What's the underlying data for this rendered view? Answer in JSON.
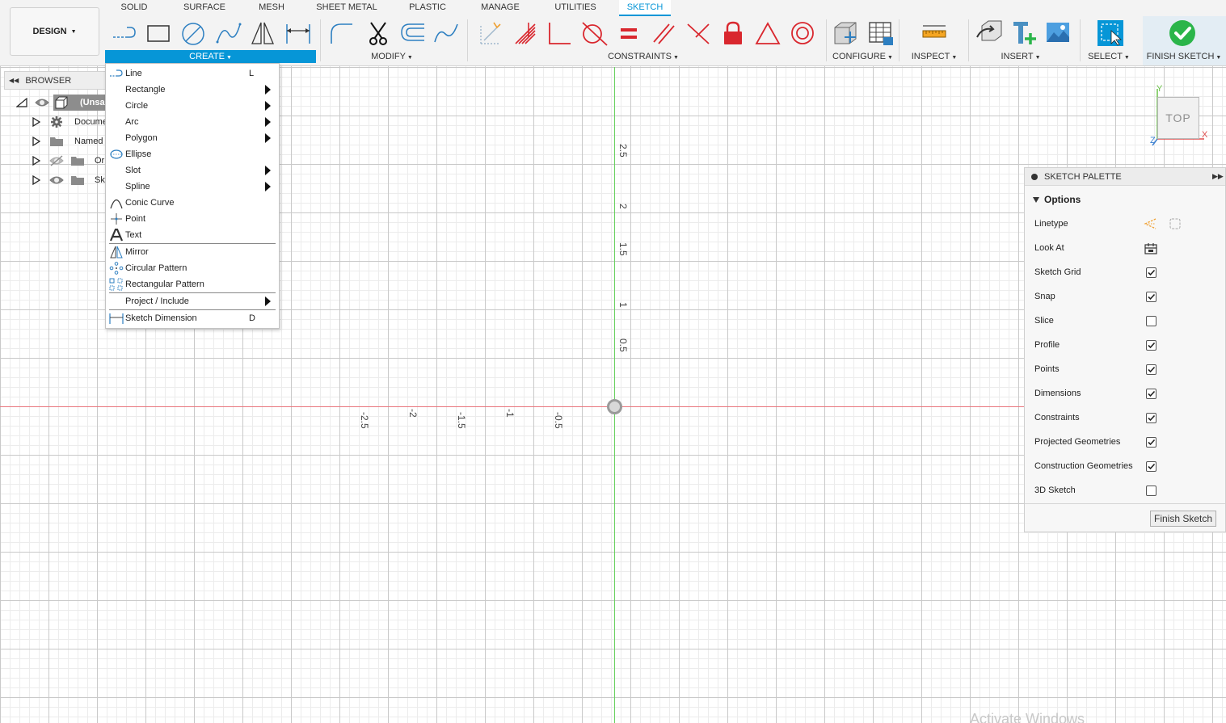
{
  "workspace": {
    "label": "DESIGN"
  },
  "tabs": [
    {
      "label": "SOLID"
    },
    {
      "label": "SURFACE"
    },
    {
      "label": "MESH"
    },
    {
      "label": "SHEET METAL"
    },
    {
      "label": "PLASTIC"
    },
    {
      "label": "MANAGE"
    },
    {
      "label": "UTILITIES"
    },
    {
      "label": "SKETCH"
    }
  ],
  "groups": {
    "create": "CREATE",
    "modify": "MODIFY",
    "constraints": "CONSTRAINTS",
    "configure": "CONFIGURE",
    "inspect": "INSPECT",
    "insert": "INSERT",
    "select": "SELECT",
    "finish": "FINISH SKETCH"
  },
  "browser": {
    "title": "BROWSER",
    "root": "(Unsa",
    "items": [
      {
        "label": "Docume"
      },
      {
        "label": "Named V"
      },
      {
        "label": "Or"
      },
      {
        "label": "Sk"
      }
    ]
  },
  "create_menu": {
    "items": [
      {
        "label": "Line",
        "shortcut": "L"
      },
      {
        "label": "Rectangle"
      },
      {
        "label": "Circle"
      },
      {
        "label": "Arc"
      },
      {
        "label": "Polygon"
      },
      {
        "label": "Ellipse"
      },
      {
        "label": "Slot"
      },
      {
        "label": "Spline"
      },
      {
        "label": "Conic Curve"
      },
      {
        "label": "Point"
      },
      {
        "label": "Text"
      },
      {
        "label": "Mirror"
      },
      {
        "label": "Circular Pattern"
      },
      {
        "label": "Rectangular Pattern"
      },
      {
        "label": "Project / Include"
      },
      {
        "label": "Sketch Dimension",
        "shortcut": "D"
      }
    ]
  },
  "axis_labels": {
    "y": [
      "2.5",
      "2",
      "1.5",
      "1",
      "0.5"
    ],
    "x": [
      "-2.5",
      "-2",
      "-1.5",
      "-1",
      "-0.5"
    ]
  },
  "viewcube": {
    "face": "TOP",
    "axis_y": "Y",
    "axis_x": "X",
    "axis_z": "Z"
  },
  "palette": {
    "title": "SKETCH PALETTE",
    "section": "Options",
    "rows": [
      {
        "label": "Linetype"
      },
      {
        "label": "Look At"
      },
      {
        "label": "Sketch Grid",
        "checked": true
      },
      {
        "label": "Snap",
        "checked": true
      },
      {
        "label": "Slice",
        "checked": false
      },
      {
        "label": "Profile",
        "checked": true
      },
      {
        "label": "Points",
        "checked": true
      },
      {
        "label": "Dimensions",
        "checked": true
      },
      {
        "label": "Constraints",
        "checked": true
      },
      {
        "label": "Projected Geometries",
        "checked": true
      },
      {
        "label": "Construction Geometries",
        "checked": true
      },
      {
        "label": "3D Sketch",
        "checked": false
      }
    ],
    "finish_label": "Finish Sketch"
  },
  "watermark": "Activate Windows",
  "colors": {
    "accent": "#0696d7",
    "x_axis": "#e9787f",
    "y_axis": "#69d15f",
    "constraint_red": "#d9272e",
    "finish_green": "#2bb54a"
  }
}
